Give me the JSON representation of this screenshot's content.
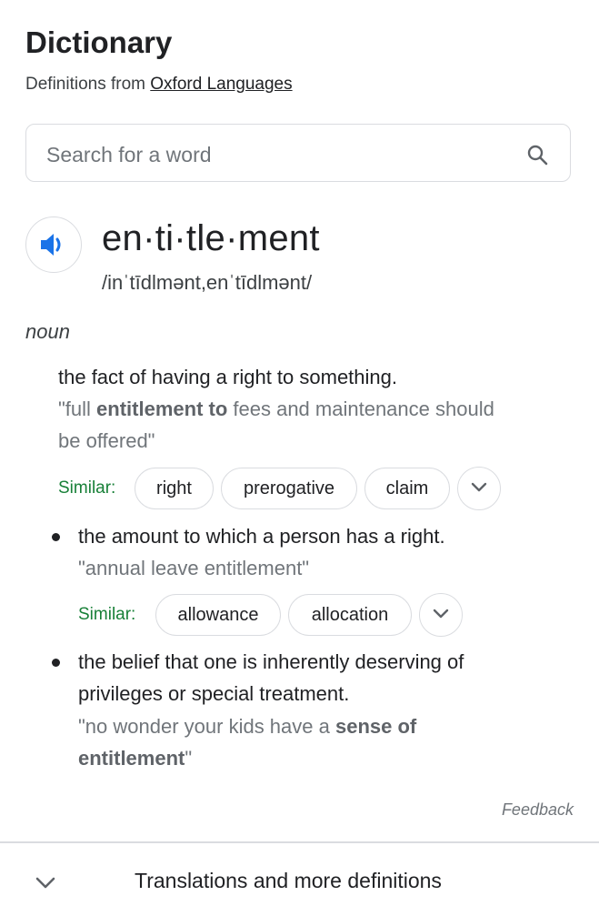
{
  "header": {
    "title": "Dictionary",
    "subtitle_prefix": "Definitions from ",
    "source_link": "Oxford Languages"
  },
  "search": {
    "placeholder": "Search for a word",
    "icon": "search-icon"
  },
  "entry": {
    "word": "en·ti·tle·ment",
    "phonetic": "/inˈtīdlmənt,enˈtīdlmənt/",
    "audio_icon": "speaker-icon",
    "part_of_speech": "noun"
  },
  "senses": [
    {
      "definition": "the fact of having a right to something.",
      "example_open": "\"full ",
      "example_bold": "entitlement to",
      "example_rest": " fees and maintenance should",
      "example_line2": "be offered\"",
      "similar_label": "Similar:",
      "similar": [
        "right",
        "prerogative",
        "claim"
      ]
    },
    {
      "definition": "the amount to which a person has a right.",
      "example": "\"annual leave entitlement\"",
      "similar_label": "Similar:",
      "similar": [
        "allowance",
        "allocation"
      ]
    },
    {
      "definition_line1": "the belief that one is inherently deserving of",
      "definition_line2": "privileges or special treatment.",
      "example_open": "\"no wonder your kids have a ",
      "example_bold": "sense of",
      "example_bold2": "entitlement",
      "example_close": "\""
    }
  ],
  "footer": {
    "feedback": "Feedback",
    "more_label": "Translations and more definitions",
    "more_icon": "chevron-down-icon"
  },
  "colors": {
    "similar_green": "#188038",
    "audio_blue": "#1a73e8",
    "border": "#dadce0"
  }
}
